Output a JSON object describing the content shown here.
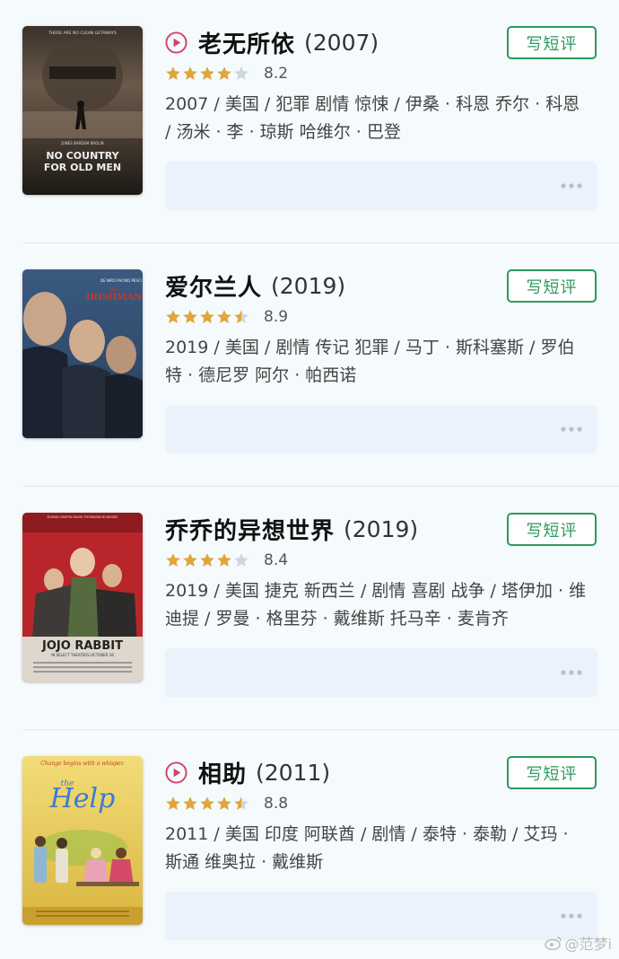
{
  "movies": [
    {
      "title": "老无所依",
      "year": "(2007)",
      "playable": true,
      "stars": 4,
      "score": "8.2",
      "info": "2007 / 美国 / 犯罪 剧情 惊悚 / 伊桑 · 科恩 乔尔 · 科恩 / 汤米 · 李 · 琼斯 哈维尔 · 巴登",
      "button": "写短评",
      "poster": {
        "tagline": "THERE ARE NO CLEAN GETAWAYS",
        "names": "JONES   BARDEM   BROLIN",
        "line1": "NO COUNTRY",
        "line2": "FOR OLD MEN",
        "bg1": "#6b5a4a",
        "bg2": "#1c1915"
      }
    },
    {
      "title": "爱尔兰人",
      "year": "(2019)",
      "playable": false,
      "stars": 4.5,
      "score": "8.9",
      "info": "2019 / 美国 / 剧情 传记 犯罪 / 马丁 · 斯科塞斯 / 罗伯特 · 德尼罗 阿尔 · 帕西诺",
      "button": "写短评",
      "poster": {
        "names": "DE NIRO   PACINO   PESCI",
        "line1": "THE",
        "line2": "IRISHMAN",
        "bg1": "#2f4a6b",
        "bg2": "#0f1826"
      }
    },
    {
      "title": "乔乔的异想世界",
      "year": "(2019)",
      "playable": false,
      "stars": 4,
      "score": "8.4",
      "info": "2019 / 美国 捷克 新西兰 / 剧情 喜剧 战争 / 塔伊加 · 维迪提 / 罗曼 · 格里芬 · 戴维斯 托马辛 · 麦肯齐",
      "button": "写短评",
      "poster": {
        "names": "ROMAN GRIFFIN DAVIS   THOMASIN MCKENZIE",
        "line1": "JOJO RABBIT",
        "line2": "IN SELECT THEATERS OCTOBER 18",
        "bg1": "#b8262b",
        "bg2": "#5a1214"
      }
    },
    {
      "title": "相助",
      "year": "(2011)",
      "playable": true,
      "stars": 4.5,
      "score": "8.8",
      "info": "2011 / 美国 印度 阿联酋 / 剧情 / 泰特 · 泰勒 / 艾玛 · 斯通 维奥拉 · 戴维斯",
      "button": "写短评",
      "poster": {
        "tagline": "Change begins with a whisper.",
        "line1": "the",
        "line2": "Help",
        "bg1": "#f1d56a",
        "bg2": "#d9b640"
      }
    }
  ],
  "watermark": "@范梦i",
  "colors": {
    "accent": "#2b9a5d",
    "play": "#d0426b",
    "star": "#e1a53a",
    "star_empty": "#cfd6dd"
  }
}
